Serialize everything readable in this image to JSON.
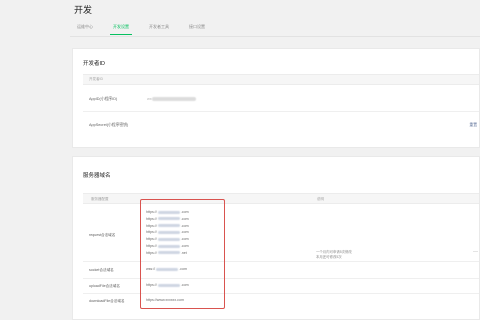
{
  "page": {
    "title": "开发"
  },
  "tabs": [
    {
      "label": "运维中心",
      "active": false
    },
    {
      "label": "开发设置",
      "active": true
    },
    {
      "label": "开发者工具",
      "active": false
    },
    {
      "label": "接口设置",
      "active": false
    }
  ],
  "dev_id_card": {
    "title": "开发者ID",
    "header": "开发者ID",
    "rows": [
      {
        "label": "AppID(小程序ID)",
        "value": "wx",
        "action": ""
      },
      {
        "label": "AppSecret(小程序密钥)",
        "value": "",
        "action": "重置"
      }
    ]
  },
  "server_card": {
    "title": "服务器域名",
    "columns": [
      "服务器配置",
      "说明"
    ],
    "rows": [
      {
        "label": "request合法域名",
        "lines": [
          "https://",
          "https://",
          "https://",
          "https://",
          "https://",
          "https://",
          "https://"
        ],
        "suffixes": [
          ".com",
          ".com",
          ".com",
          ".com",
          ".com",
          ".com",
          ".net"
        ]
      },
      {
        "label": "socket合法域名",
        "lines": [
          "wss://"
        ],
        "suffixes": [
          ".com"
        ]
      },
      {
        "label": "uploadFile合法域名",
        "lines": [
          "https://"
        ],
        "suffixes": [
          ".com"
        ]
      },
      {
        "label": "downloadFile合法域名",
        "lines": [
          "https://www.xxxxxx.com"
        ],
        "suffixes": [
          ""
        ]
      }
    ],
    "note": [
      "一个月内可申请5次修改",
      "本月还可修改5次"
    ]
  }
}
